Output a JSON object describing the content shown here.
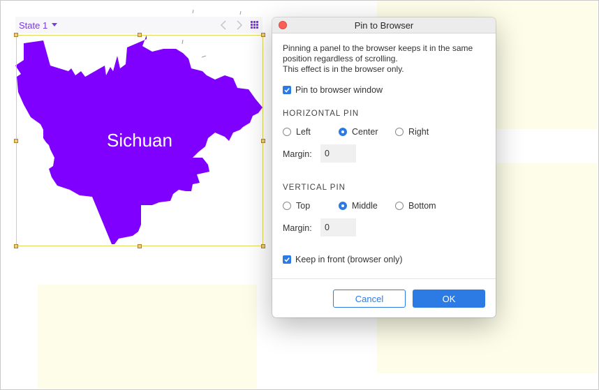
{
  "canvas": {
    "state_label": "State 1",
    "map_label": "Sichuan",
    "map_fill": "#8000ff",
    "accent": "#7a3bd9"
  },
  "dialog": {
    "title": "Pin to Browser",
    "description": [
      "Pinning a panel to the browser keeps it in the same",
      "position regardless of scrolling.",
      "This effect is in the browser only."
    ],
    "pin_checkbox": {
      "label": "Pin to browser window",
      "checked": true
    },
    "horizontal": {
      "heading": "HORIZONTAL PIN",
      "options": [
        "Left",
        "Center",
        "Right"
      ],
      "selected": "Center",
      "margin_label": "Margin:",
      "margin_value": "0"
    },
    "vertical": {
      "heading": "VERTICAL PIN",
      "options": [
        "Top",
        "Middle",
        "Bottom"
      ],
      "selected": "Middle",
      "margin_label": "Margin:",
      "margin_value": "0"
    },
    "front_checkbox": {
      "label": "Keep in front (browser only)",
      "checked": true
    },
    "cancel_label": "Cancel",
    "ok_label": "OK",
    "accent": "#2c7be5",
    "close_color": "#fc5f57"
  }
}
